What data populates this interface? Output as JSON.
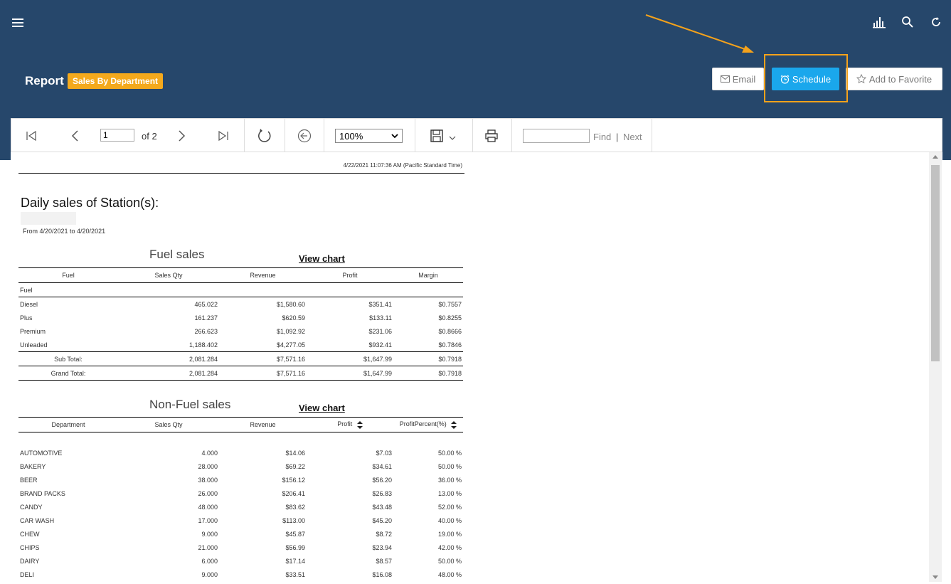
{
  "header": {
    "report_label": "Report",
    "report_badge": "Sales By Department",
    "email_label": "Email",
    "schedule_label": "Schedule",
    "favorite_label": "Add to Favorite"
  },
  "toolbar": {
    "page_value": "1",
    "page_of": "of 2",
    "zoom_value": "100%",
    "find_label": "Find",
    "separator": "|",
    "next_label": "Next"
  },
  "report": {
    "timestamp": "4/22/2021 11:07:36 AM (Pacific Standard Time)",
    "title": "Daily sales of Station(s):",
    "period": "From 4/20/2021 to 4/20/2021",
    "fuel": {
      "title": "Fuel sales",
      "view_chart": "View chart",
      "headers": [
        "Fuel",
        "Sales Qty",
        "Revenue",
        "Profit",
        "Margin"
      ],
      "group": "Fuel",
      "rows": [
        [
          "Diesel",
          "465.022",
          "$1,580.60",
          "$351.41",
          "$0.7557"
        ],
        [
          "Plus",
          "161.237",
          "$620.59",
          "$133.11",
          "$0.8255"
        ],
        [
          "Premium",
          "266.623",
          "$1,092.92",
          "$231.06",
          "$0.8666"
        ],
        [
          "Unleaded",
          "1,188.402",
          "$4,277.05",
          "$932.41",
          "$0.7846"
        ]
      ],
      "subtotal": [
        "Sub Total:",
        "2,081.284",
        "$7,571.16",
        "$1,647.99",
        "$0.7918"
      ],
      "grandtotal": [
        "Grand Total:",
        "2,081.284",
        "$7,571.16",
        "$1,647.99",
        "$0.7918"
      ]
    },
    "nonfuel": {
      "title": "Non-Fuel sales",
      "view_chart": "View chart",
      "headers": [
        "Department",
        "Sales Qty",
        "Revenue",
        "Profit",
        "ProfitPercent(%)"
      ],
      "rows": [
        [
          "AUTOMOTIVE",
          "4.000",
          "$14.06",
          "$7.03",
          "50.00 %"
        ],
        [
          "BAKERY",
          "28.000",
          "$69.22",
          "$34.61",
          "50.00 %"
        ],
        [
          "BEER",
          "38.000",
          "$156.12",
          "$56.20",
          "36.00 %"
        ],
        [
          "BRAND PACKS",
          "26.000",
          "$206.41",
          "$26.83",
          "13.00 %"
        ],
        [
          "CANDY",
          "48.000",
          "$83.62",
          "$43.48",
          "52.00 %"
        ],
        [
          "CAR WASH",
          "17.000",
          "$113.00",
          "$45.20",
          "40.00 %"
        ],
        [
          "CHEW",
          "9.000",
          "$45.87",
          "$8.72",
          "19.00 %"
        ],
        [
          "CHIPS",
          "21.000",
          "$56.99",
          "$23.94",
          "42.00 %"
        ],
        [
          "DAIRY",
          "6.000",
          "$17.14",
          "$8.57",
          "50.00 %"
        ],
        [
          "DELI",
          "9.000",
          "$33.51",
          "$16.08",
          "48.00 %"
        ]
      ]
    }
  }
}
